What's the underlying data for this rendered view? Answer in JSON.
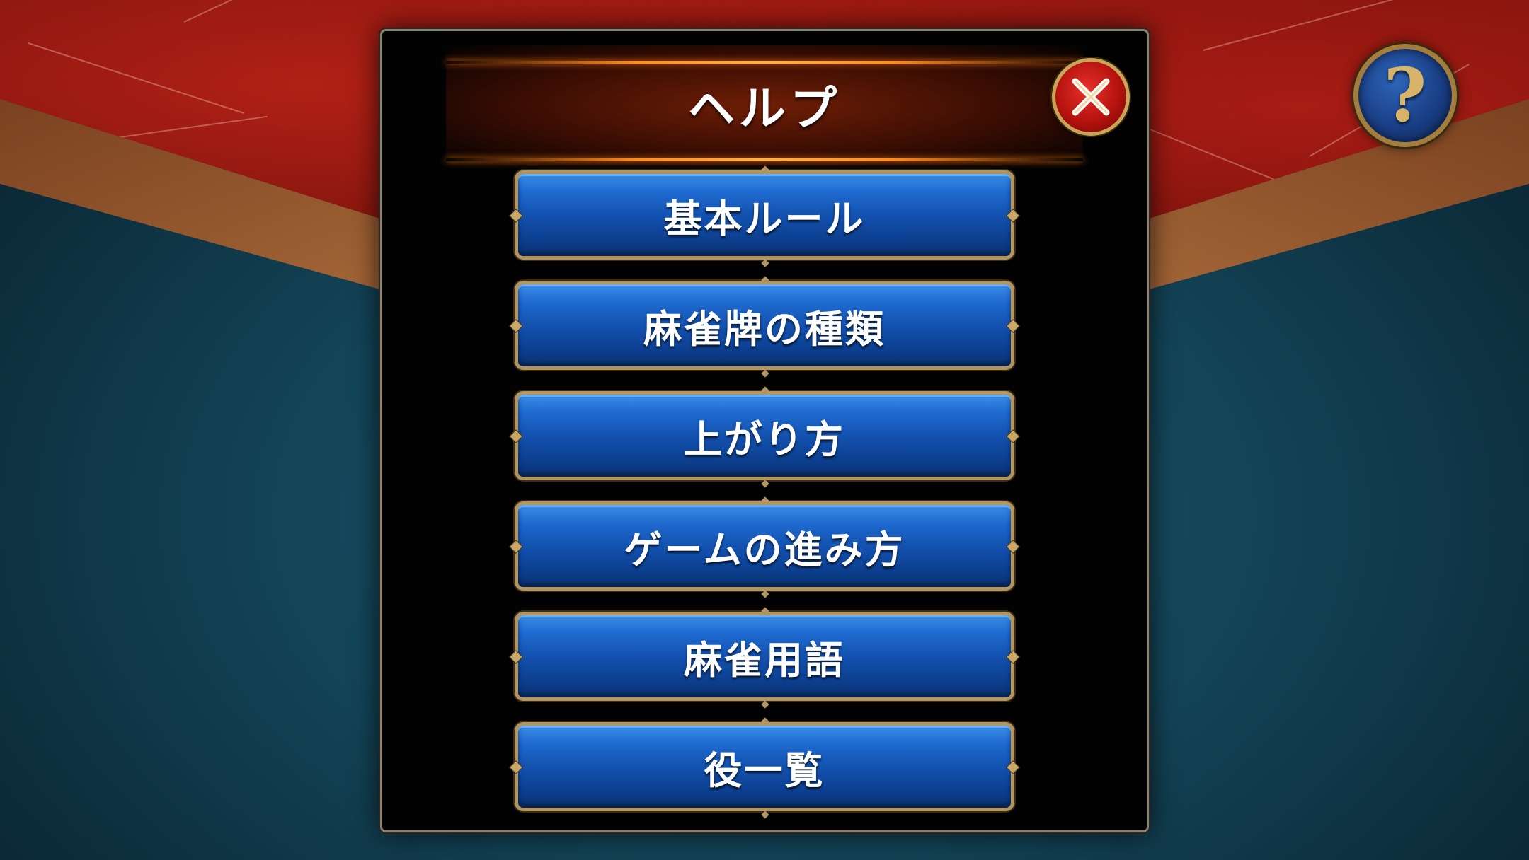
{
  "dialog": {
    "title": "ヘルプ",
    "close_icon": "close-x-icon"
  },
  "help_button": {
    "icon": "question-mark-icon",
    "glyph": "?"
  },
  "menu": {
    "items": [
      {
        "label": "基本ルール"
      },
      {
        "label": "麻雀牌の種類"
      },
      {
        "label": "上がり方"
      },
      {
        "label": "ゲームの進み方"
      },
      {
        "label": "麻雀用語"
      },
      {
        "label": "役一覧"
      }
    ]
  },
  "colors": {
    "button_blue": "#1352b0",
    "button_border_gold": "#b19563",
    "close_red": "#b5120e",
    "header_glow": "#ff8c1e"
  }
}
